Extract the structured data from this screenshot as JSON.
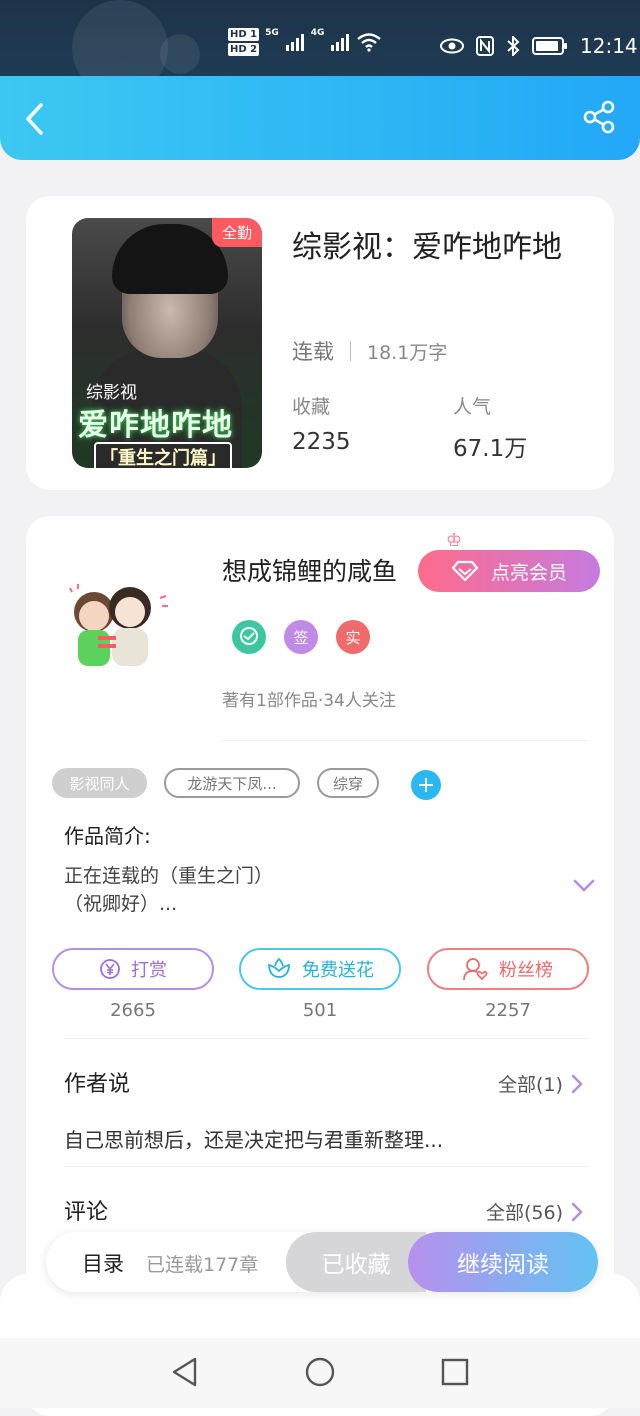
{
  "status_bar": {
    "sim1": "HD 1",
    "sim2": "HD 2",
    "net1": "5G",
    "net2": "4G",
    "time": "12:14",
    "icons": [
      "eye-icon",
      "nfc-icon",
      "bluetooth-icon",
      "battery-icon"
    ]
  },
  "header": {
    "back_icon": "chevron-left-icon",
    "share_icon": "share-icon"
  },
  "book": {
    "cover": {
      "badge": "全勤",
      "subtitle_line": "综影视",
      "title_line": "爱咋地咋地",
      "tagline": "「重生之门篇」"
    },
    "title": "综影视：爱咋地咋地",
    "status": "连载",
    "word_count": "18.1万字",
    "stats": [
      {
        "label": "收藏",
        "value": "2235"
      },
      {
        "label": "人气",
        "value": "67.1万"
      }
    ]
  },
  "author": {
    "name": "想成锦鲤的咸鱼",
    "vip_button": "点亮会员",
    "badges": [
      "签",
      "实"
    ],
    "meta": "著有1部作品·34人关注"
  },
  "tags": [
    "影视同人",
    "龙游天下凤...",
    "综穿"
  ],
  "intro": {
    "label": "作品简介:",
    "text_line1": "正在连载的（重生之门）",
    "text_line2": "（祝卿好）..."
  },
  "actions": [
    {
      "label": "打赏",
      "icon": "yen-coin-icon",
      "count": "2665"
    },
    {
      "label": "免费送花",
      "icon": "flower-icon",
      "count": "501"
    },
    {
      "label": "粉丝榜",
      "icon": "fan-ranking-icon",
      "count": "2257"
    }
  ],
  "author_says": {
    "title": "作者说",
    "more": "全部(1)",
    "text": "自己思前想后，还是决定把与君重新整理..."
  },
  "comments": {
    "title": "评论",
    "more": "全部(56)"
  },
  "bottom_bar": {
    "toc": "目录",
    "chapters": "已连载177章",
    "collected": "已收藏",
    "continue": "继续阅读"
  },
  "colors": {
    "header": "#22a8f6",
    "accent_purple": "#b58fe0",
    "accent_cyan": "#49c8e8",
    "accent_red": "#ef7f7f"
  }
}
